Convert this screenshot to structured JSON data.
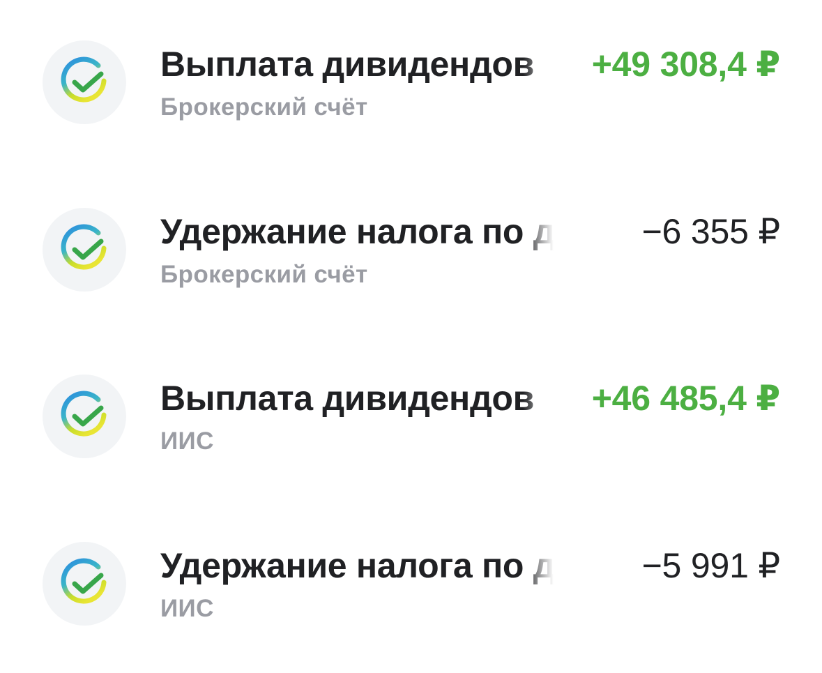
{
  "colors": {
    "positive": "#4caf42",
    "negative": "#202124",
    "subtitle": "#9a9ca3",
    "icon_bg": "#f2f4f6"
  },
  "operations": [
    {
      "icon": "sber-check-icon",
      "title": "Выплата дивидендов",
      "subtitle": "Брокерский счёт",
      "amount": "+49 308,4 ₽",
      "sign": "positive"
    },
    {
      "icon": "sber-check-icon",
      "title": "Удержание налога по дивидендам",
      "subtitle": "Брокерский счёт",
      "amount": "−6 355 ₽",
      "sign": "negative"
    },
    {
      "icon": "sber-check-icon",
      "title": "Выплата дивидендов",
      "subtitle": "ИИС",
      "amount": "+46 485,4 ₽",
      "sign": "positive"
    },
    {
      "icon": "sber-check-icon",
      "title": "Удержание налога по дивидендам",
      "subtitle": "ИИС",
      "amount": "−5 991 ₽",
      "sign": "negative"
    }
  ]
}
